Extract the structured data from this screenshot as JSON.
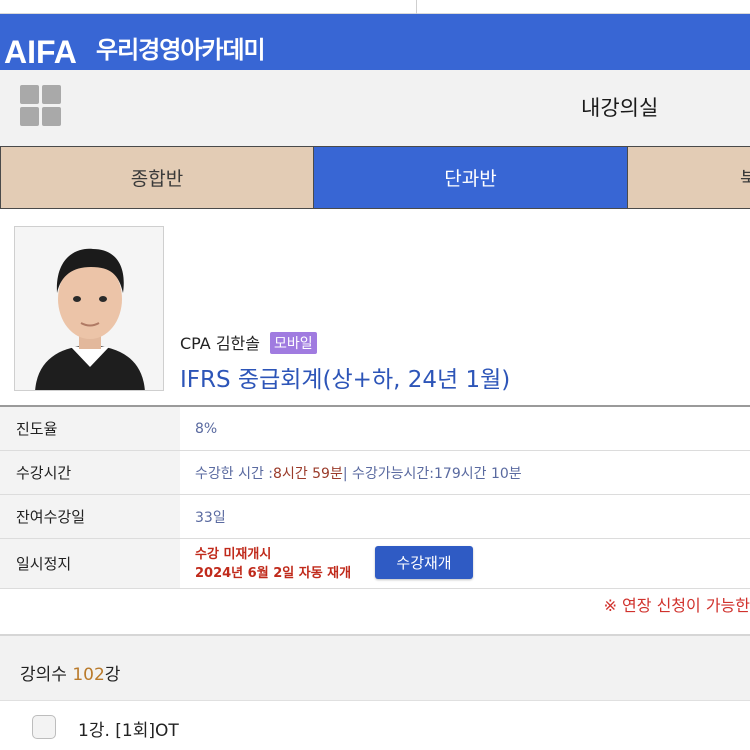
{
  "brand": {
    "logo": "AIFA",
    "name": "우리경영아카데미"
  },
  "header": {
    "menu_icon": "grid-icon",
    "title": "내강의실"
  },
  "tabs": [
    {
      "label": "종합반",
      "active": false
    },
    {
      "label": "단과반",
      "active": true
    },
    {
      "label": "북",
      "active": false
    }
  ],
  "course": {
    "instructor": "CPA 김한솔",
    "badge": "모바일",
    "title": "IFRS 중급회계(상+하, 24년 1월)"
  },
  "info": {
    "progress": {
      "label": "진도율",
      "value": "8%"
    },
    "study_time": {
      "label": "수강시간",
      "studied_prefix": "수강한 시간 : ",
      "studied_value": "8시간 59분",
      "remaining": " | 수강가능시간:179시간 10분"
    },
    "remaining_days": {
      "label": "잔여수강일",
      "value": "33일"
    },
    "pause": {
      "label": "일시정지",
      "status_line1": "수강 미재개시",
      "status_line2": "2024년 6월 2일 자동 재개",
      "button": "수강재개"
    }
  },
  "notice": "※ 연장 신청이 가능한",
  "lectures": {
    "count_label": "강의수 ",
    "count": "102",
    "count_suffix": "강",
    "items": [
      {
        "title": "1강. [1회]OT"
      }
    ]
  },
  "colors": {
    "brand_blue": "#3866d4",
    "tab_inactive": "#e3ccb5",
    "badge_purple": "#a07be0",
    "alert_red": "#c02a1b"
  }
}
